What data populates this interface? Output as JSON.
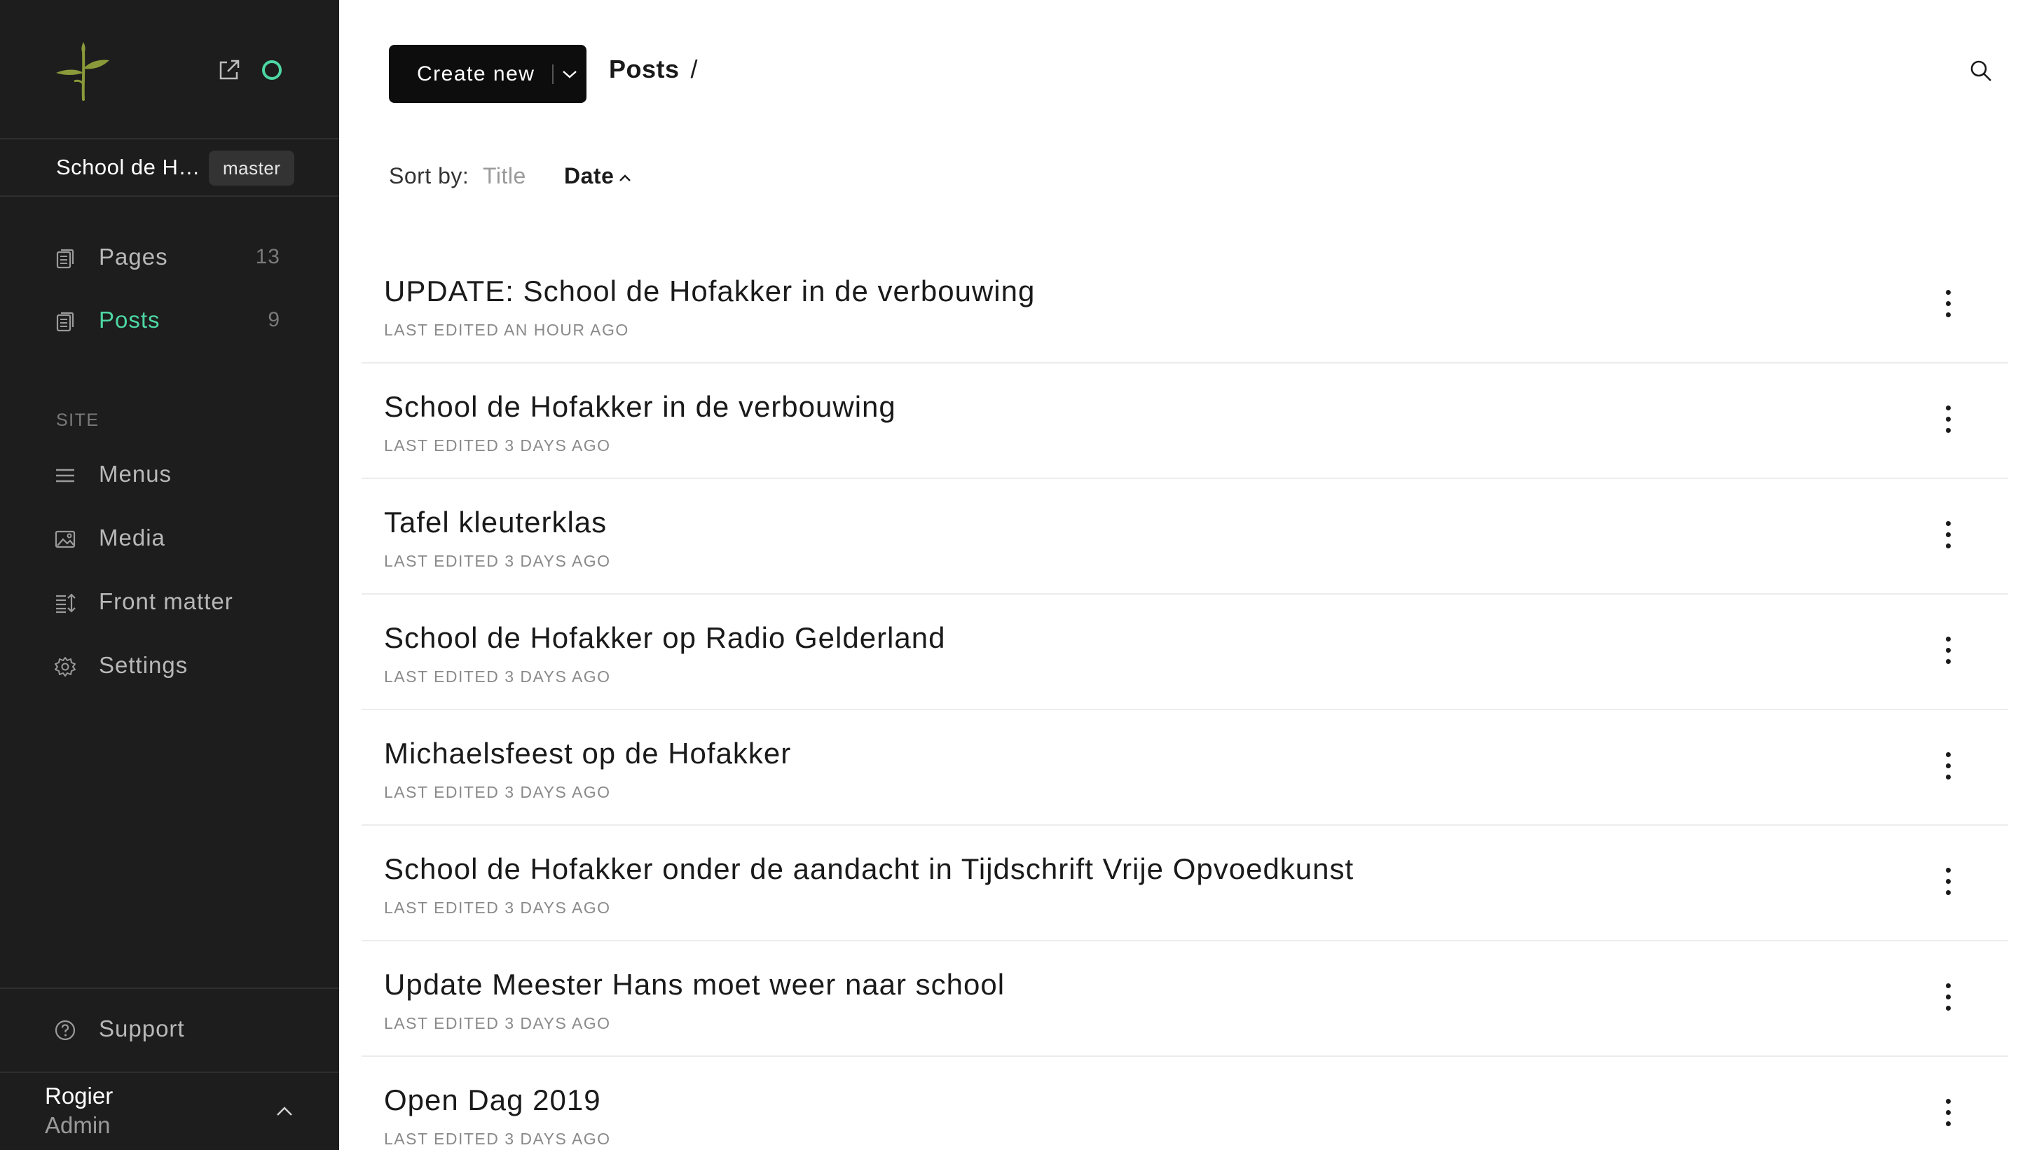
{
  "sidebar": {
    "site_name": "School de Hofakker",
    "branch": "master",
    "nav": [
      {
        "label": "Pages",
        "count": "13",
        "icon": "pages-icon"
      },
      {
        "label": "Posts",
        "count": "9",
        "icon": "posts-icon",
        "active": true
      }
    ],
    "section_label": "SITE",
    "site_nav": [
      {
        "label": "Menus",
        "icon": "menu-icon"
      },
      {
        "label": "Media",
        "icon": "image-icon"
      },
      {
        "label": "Front matter",
        "icon": "front-matter-icon"
      },
      {
        "label": "Settings",
        "icon": "gear-icon"
      }
    ],
    "support_label": "Support",
    "user": {
      "name": "Rogier",
      "role": "Admin"
    }
  },
  "toolbar": {
    "create_label": "Create new",
    "breadcrumb": "Posts",
    "breadcrumb_sep": "/"
  },
  "sort": {
    "label": "Sort by:",
    "options": [
      "Title",
      "Date"
    ],
    "active": "Date"
  },
  "posts": [
    {
      "title": "UPDATE: School de Hofakker in de verbouwing",
      "meta": "LAST EDITED AN HOUR AGO"
    },
    {
      "title": "School de Hofakker in de verbouwing",
      "meta": "LAST EDITED 3 DAYS AGO"
    },
    {
      "title": "Tafel kleuterklas",
      "meta": "LAST EDITED 3 DAYS AGO"
    },
    {
      "title": "School de Hofakker op Radio Gelderland",
      "meta": "LAST EDITED 3 DAYS AGO"
    },
    {
      "title": "Michaelsfeest op de Hofakker",
      "meta": "LAST EDITED 3 DAYS AGO"
    },
    {
      "title": "School de Hofakker onder de aandacht in Tijdschrift Vrije Opvoedkunst",
      "meta": "LAST EDITED 3 DAYS AGO"
    },
    {
      "title": "Update Meester Hans moet weer naar school",
      "meta": "LAST EDITED 3 DAYS AGO"
    },
    {
      "title": "Open Dag 2019",
      "meta": "LAST EDITED 3 DAYS AGO"
    }
  ],
  "colors": {
    "sidebar_bg": "#1d1d1d",
    "accent": "#4dd6a3",
    "logo_green": "#8a9a3a",
    "button_bg": "#0d0d0d"
  }
}
